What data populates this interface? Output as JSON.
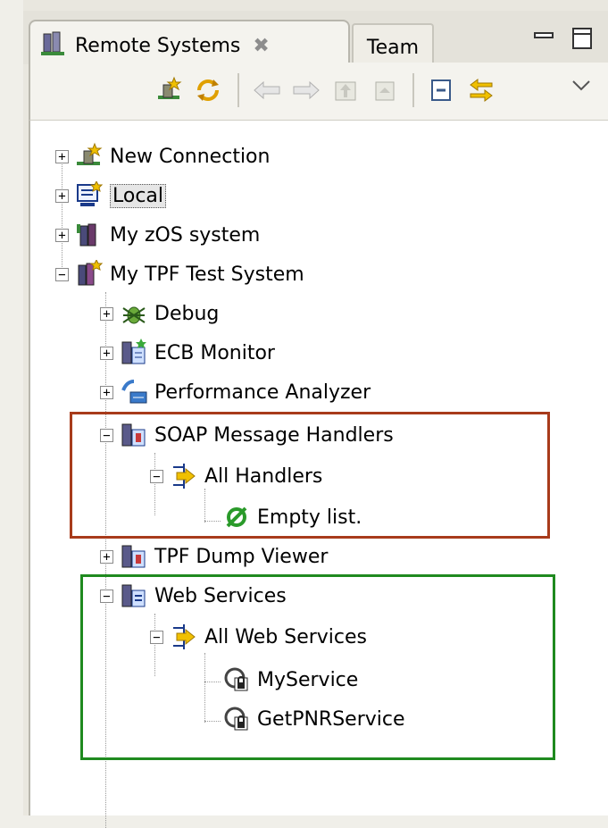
{
  "tabs": {
    "remote_systems": "Remote Systems",
    "team": "Team",
    "close_glyph": "✖"
  },
  "tree": {
    "items": [
      {
        "label": "New Connection",
        "icon": "new-connection-icon"
      },
      {
        "label": "Local",
        "icon": "local-monitor-icon"
      },
      {
        "label": "My zOS system",
        "icon": "zos-system-icon"
      },
      {
        "label": "My TPF Test System",
        "icon": "tpf-system-icon"
      },
      {
        "label": "Debug",
        "icon": "debug-bug-icon"
      },
      {
        "label": "ECB Monitor",
        "icon": "ecb-monitor-icon"
      },
      {
        "label": "Performance Analyzer",
        "icon": "performance-analyzer-icon"
      },
      {
        "label": "SOAP Message Handlers",
        "icon": "soap-handlers-icon"
      },
      {
        "label": "All Handlers",
        "icon": "all-handlers-icon"
      },
      {
        "label": "Empty list.",
        "icon": "empty-list-icon"
      },
      {
        "label": "TPF Dump Viewer",
        "icon": "dump-viewer-icon"
      },
      {
        "label": "Web Services",
        "icon": "web-services-icon"
      },
      {
        "label": "All Web Services",
        "icon": "all-web-services-icon"
      },
      {
        "label": "MyService",
        "icon": "service-icon"
      },
      {
        "label": "GetPNRService",
        "icon": "service-icon"
      }
    ]
  },
  "colors": {
    "highlight_red": "#a83b1b",
    "highlight_green": "#1f8a1f"
  }
}
